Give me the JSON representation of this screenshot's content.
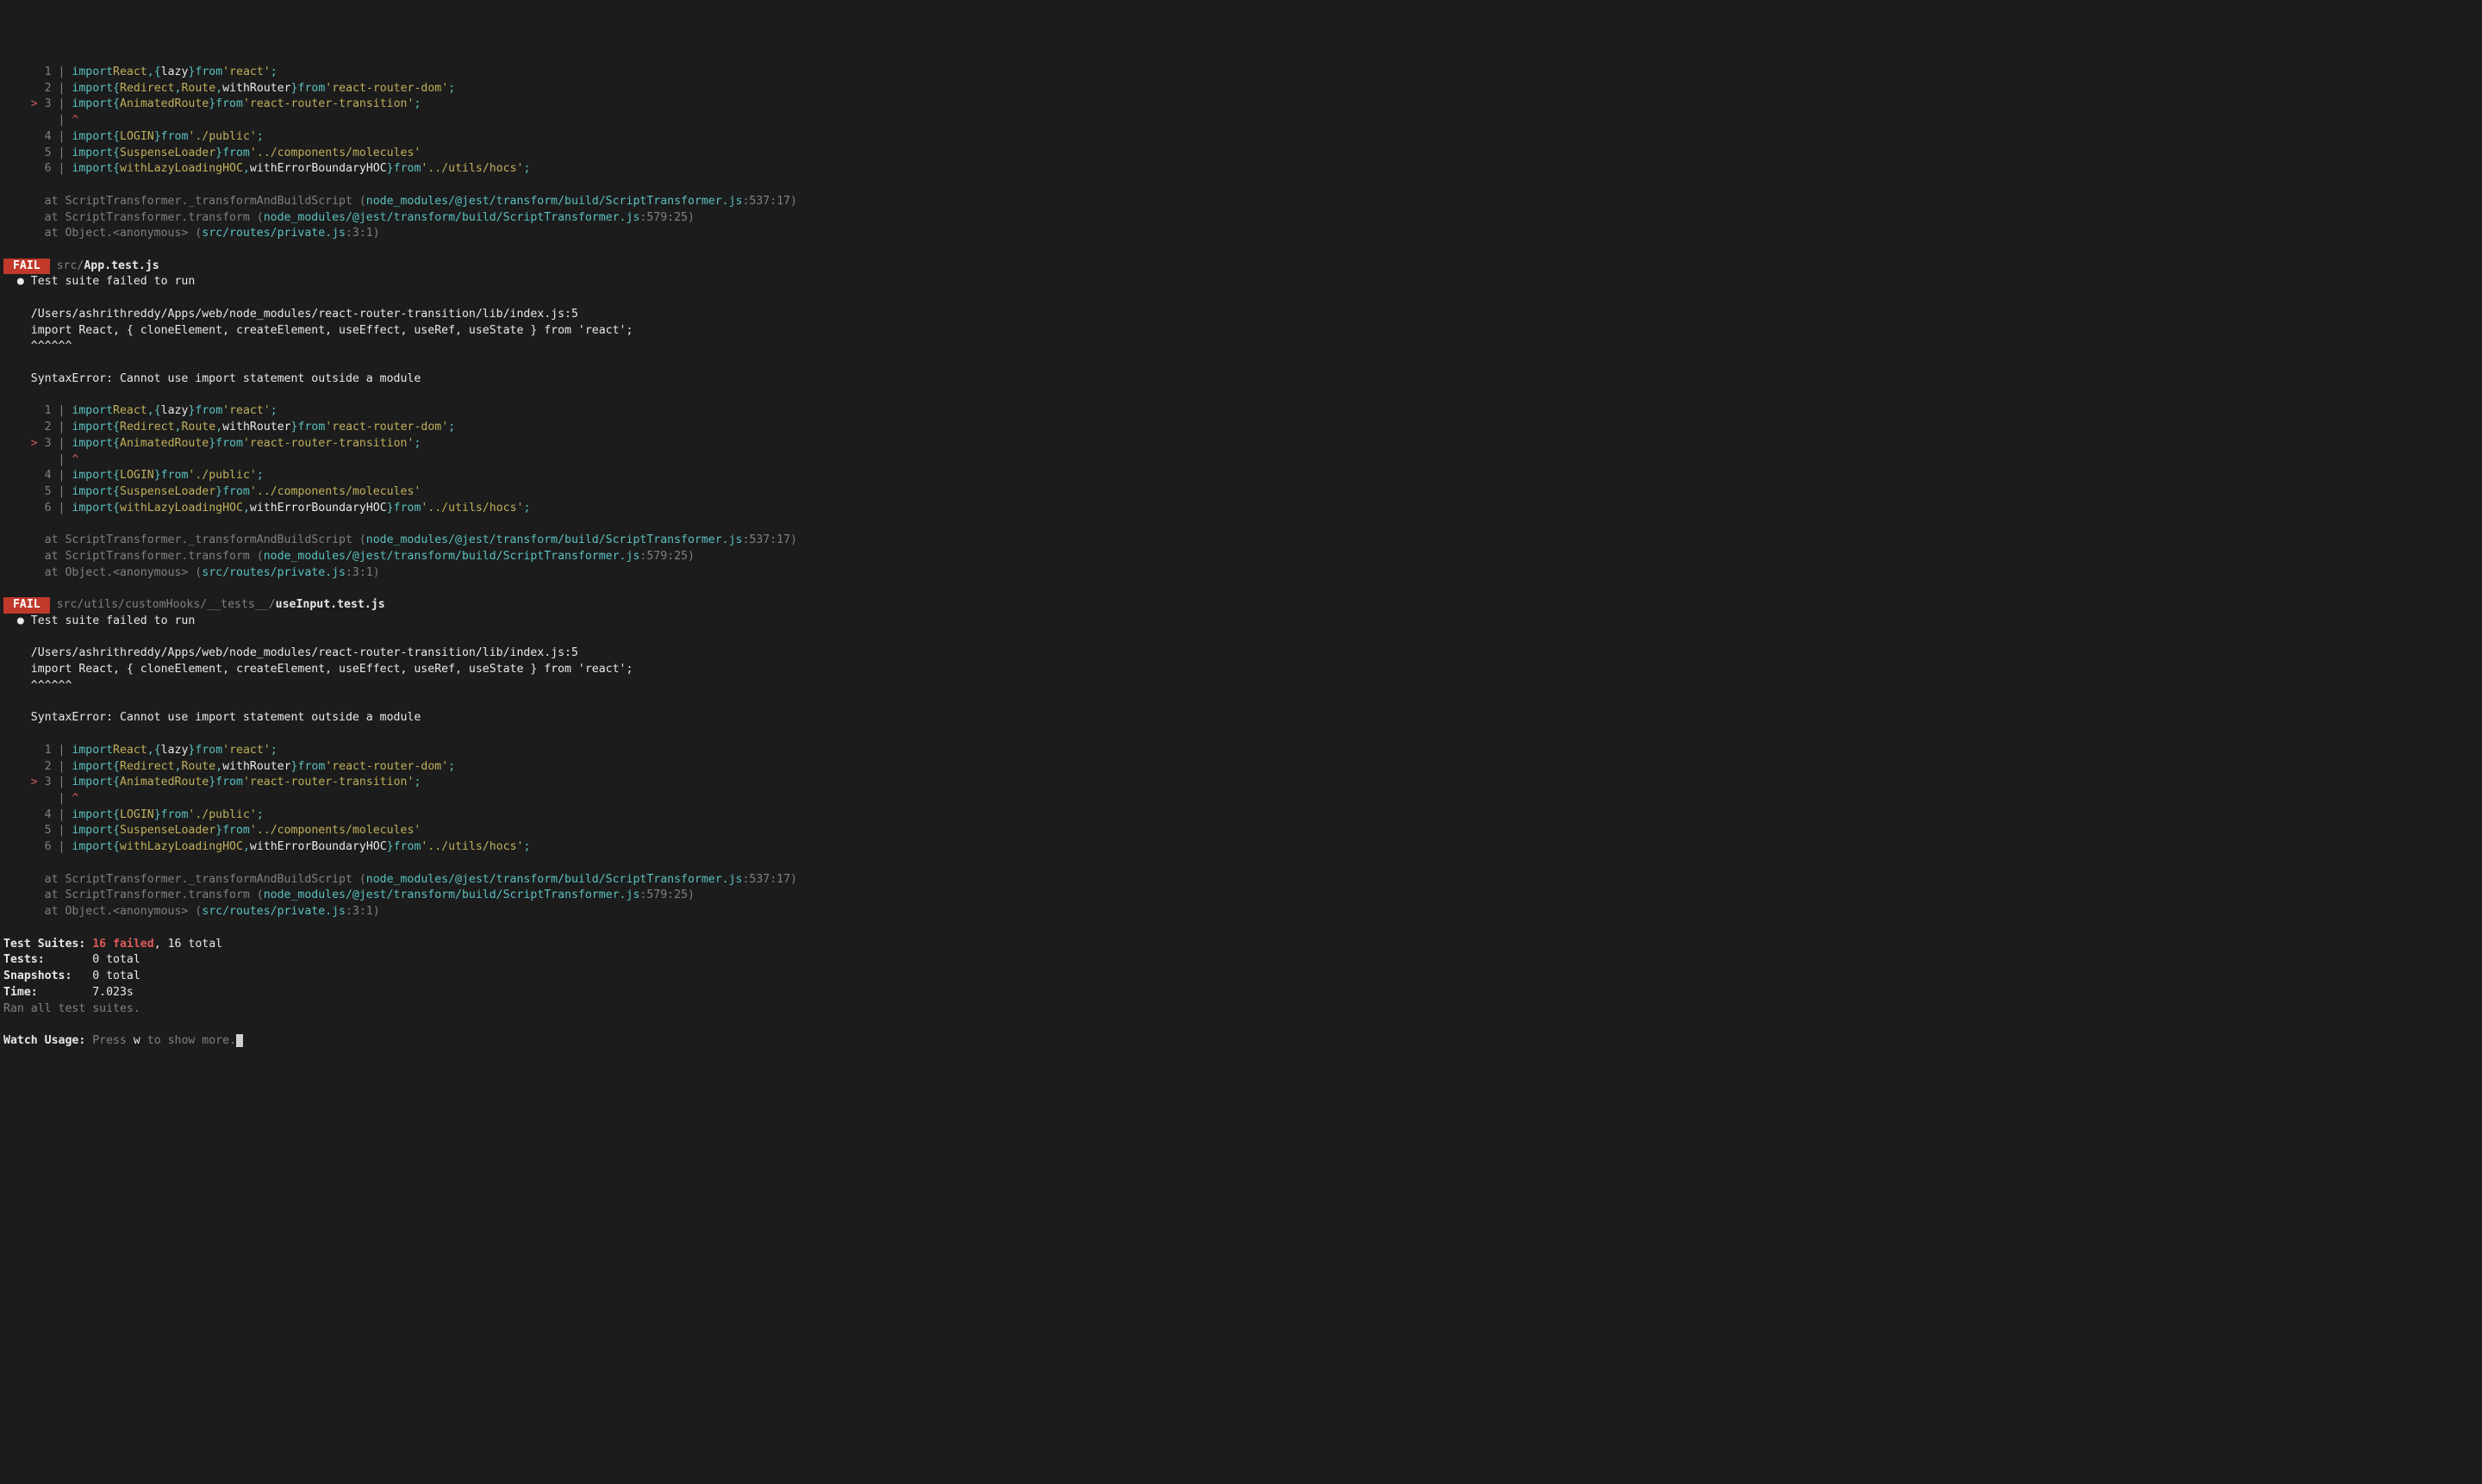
{
  "codeBlock": {
    "lines": [
      {
        "num": "1",
        "marker": " ",
        "tokens": [
          [
            "import",
            "import"
          ],
          [
            " "
          ],
          [
            "ident",
            "React"
          ],
          [
            "symbol",
            ","
          ],
          [
            " "
          ],
          [
            "symbol",
            "{"
          ],
          [
            " "
          ],
          [
            "whitep",
            "lazy"
          ],
          [
            " "
          ],
          [
            "symbol",
            "}"
          ],
          [
            " "
          ],
          [
            "kw-from",
            "from"
          ],
          [
            " "
          ],
          [
            "str",
            "'react'"
          ],
          [
            "symbol",
            ";"
          ]
        ]
      },
      {
        "num": "2",
        "marker": " ",
        "tokens": [
          [
            "import",
            "import"
          ],
          [
            " "
          ],
          [
            "symbol",
            "{"
          ],
          [
            " "
          ],
          [
            "ident",
            "Redirect"
          ],
          [
            "symbol",
            ","
          ],
          [
            " "
          ],
          [
            "ident",
            "Route"
          ],
          [
            "symbol",
            ","
          ],
          [
            " "
          ],
          [
            "whitep",
            "withRouter"
          ],
          [
            " "
          ],
          [
            "symbol",
            "}"
          ],
          [
            " "
          ],
          [
            "kw-from",
            "from"
          ],
          [
            " "
          ],
          [
            "str",
            "'react-router-dom'"
          ],
          [
            "symbol",
            ";"
          ]
        ]
      },
      {
        "num": "3",
        "marker": ">",
        "tokens": [
          [
            "import",
            "import"
          ],
          [
            " "
          ],
          [
            "symbol",
            "{"
          ],
          [
            " "
          ],
          [
            "ident",
            "AnimatedRoute"
          ],
          [
            " "
          ],
          [
            "symbol",
            "}"
          ],
          [
            " "
          ],
          [
            "kw-from",
            "from"
          ],
          [
            " "
          ],
          [
            "str",
            "'react-router-transition'"
          ],
          [
            "symbol",
            ";"
          ]
        ]
      },
      {
        "num": " ",
        "marker": " ",
        "tokens": [
          [
            "red",
            "^"
          ]
        ]
      },
      {
        "num": "4",
        "marker": " ",
        "tokens": [
          [
            "import",
            "import"
          ],
          [
            " "
          ],
          [
            "symbol",
            "{"
          ],
          [
            " "
          ],
          [
            "ident",
            "LOGIN"
          ],
          [
            " "
          ],
          [
            "symbol",
            "}"
          ],
          [
            " "
          ],
          [
            "kw-from",
            "from"
          ],
          [
            " "
          ],
          [
            "str",
            "'./public'"
          ],
          [
            "symbol",
            ";"
          ]
        ]
      },
      {
        "num": "5",
        "marker": " ",
        "tokens": [
          [
            "import",
            "import"
          ],
          [
            " "
          ],
          [
            "symbol",
            "{"
          ],
          [
            " "
          ],
          [
            "ident",
            "SuspenseLoader"
          ],
          [
            " "
          ],
          [
            "symbol",
            "}"
          ],
          [
            " "
          ],
          [
            "kw-from",
            "from"
          ],
          [
            " "
          ],
          [
            "str",
            "'../components/molecules'"
          ]
        ]
      },
      {
        "num": "6",
        "marker": " ",
        "tokens": [
          [
            "import",
            "import"
          ],
          [
            " "
          ],
          [
            "symbol",
            "{"
          ],
          [
            " "
          ],
          [
            "ident",
            "withLazyLoadingHOC"
          ],
          [
            "symbol",
            ","
          ],
          [
            " "
          ],
          [
            "whitep",
            "withErrorBoundaryHOC"
          ],
          [
            " "
          ],
          [
            "symbol",
            "}"
          ],
          [
            " "
          ],
          [
            "kw-from",
            "from"
          ],
          [
            " "
          ],
          [
            "str",
            "'../utils/hocs'"
          ],
          [
            "symbol",
            ";"
          ]
        ]
      }
    ]
  },
  "stack": [
    {
      "at": "at ScriptTransformer._transformAndBuildScript (",
      "path": "node_modules/@jest/transform/build/ScriptTransformer.js",
      "loc": ":537:17)"
    },
    {
      "at": "at ScriptTransformer.transform (",
      "path": "node_modules/@jest/transform/build/ScriptTransformer.js",
      "loc": ":579:25)"
    },
    {
      "at": "at Object.<anonymous> (",
      "path": "src/routes/private.js",
      "loc": ":3:1)"
    }
  ],
  "suites": [
    {
      "fail": "FAIL",
      "prefix": "src/",
      "file": "App.test.js"
    },
    {
      "fail": "FAIL",
      "prefix": "src/utils/customHooks/__tests__/",
      "file": "useInput.test.js"
    }
  ],
  "suiteFailMsg": "Test suite failed to run",
  "errorPath": "/Users/ashrithreddy/Apps/web/node_modules/react-router-transition/lib/index.js:5",
  "errorImportLine": "import React, { cloneElement, createElement, useEffect, useRef, useState } from 'react';",
  "carets": "^^^^^^",
  "syntaxError": "SyntaxError: Cannot use import statement outside a module",
  "summary": {
    "testSuitesLabel": "Test Suites:",
    "testSuitesFailed": "16 failed",
    "testSuitesTotal": ", 16 total",
    "testsLabel": "Tests:",
    "testsValue": "0 total",
    "snapshotsLabel": "Snapshots:",
    "snapshotsValue": "0 total",
    "timeLabel": "Time:",
    "timeValue": "7.023s",
    "ranAll": "Ran all test suites."
  },
  "watch": {
    "label": "Watch Usage:",
    "press": "Press ",
    "key": "w",
    "rest": " to show more."
  }
}
